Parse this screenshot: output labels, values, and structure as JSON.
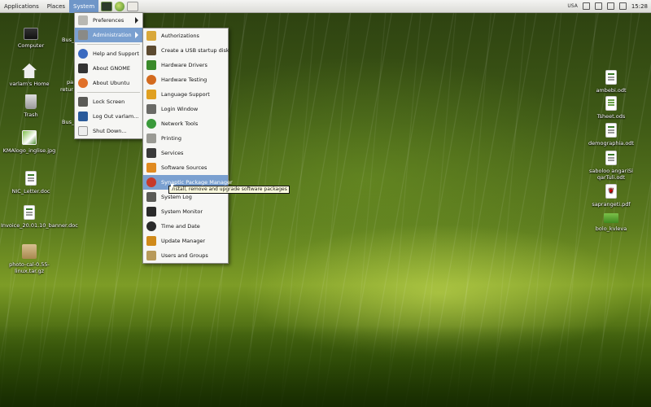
{
  "panel": {
    "menus": [
      "Applications",
      "Places",
      "System"
    ],
    "keyboard_layout": "USA",
    "clock": "15:28"
  },
  "desktop_left": [
    {
      "label": "Computer",
      "icon": "computer-icon"
    },
    {
      "label": "varlam's Home",
      "icon": "home-folder-icon"
    },
    {
      "label": "Trash",
      "icon": "trash-icon"
    },
    {
      "label": "KMAlogo_inglise.jpg",
      "icon": "image-file-icon"
    },
    {
      "label": "NIC_Letter.doc",
      "icon": "document-icon"
    },
    {
      "label": "Invoice_20.01.10_banner.doc",
      "icon": "document-icon"
    },
    {
      "label": "photo-cal-0.55-linux.tar.gz",
      "icon": "archive-icon"
    }
  ],
  "desktop_fragments": [
    "Bus_",
    "pa",
    "retur",
    "Bus_"
  ],
  "desktop_right": [
    {
      "label": "ambebi.odt",
      "icon": "document-icon"
    },
    {
      "label": "Tsheet.ods",
      "icon": "spreadsheet-icon"
    },
    {
      "label": "demographia.odt",
      "icon": "document-icon"
    },
    {
      "label": "saboloo angariSi qarTuli.odt",
      "icon": "document-icon"
    },
    {
      "label": "saprangeti.pdf",
      "icon": "pdf-icon"
    },
    {
      "label": "bolo_kvleva",
      "icon": "folder-icon"
    }
  ],
  "system_menu": {
    "items": [
      {
        "label": "Preferences",
        "submenu": true
      },
      {
        "label": "Administration",
        "submenu": true,
        "selected": true
      },
      {
        "label": "Help and Support"
      },
      {
        "label": "About GNOME"
      },
      {
        "label": "About Ubuntu"
      },
      {
        "label": "Lock Screen"
      },
      {
        "label": "Log Out varlam..."
      },
      {
        "label": "Shut Down..."
      }
    ]
  },
  "admin_menu": {
    "items": [
      {
        "label": "Authorizations",
        "color": "#d9a83a"
      },
      {
        "label": "Create a USB startup disk",
        "color": "#5c4a30"
      },
      {
        "label": "Hardware Drivers",
        "color": "#3a8a2a"
      },
      {
        "label": "Hardware Testing",
        "color": "#d36a1e"
      },
      {
        "label": "Language Support",
        "color": "#e0a020"
      },
      {
        "label": "Login Window",
        "color": "#6a6a66"
      },
      {
        "label": "Network Tools",
        "color": "#3a9a3a"
      },
      {
        "label": "Printing",
        "color": "#9a9a94"
      },
      {
        "label": "Services",
        "color": "#3a3a3a"
      },
      {
        "label": "Software Sources",
        "color": "#e08a20"
      },
      {
        "label": "Synaptic Package Manager",
        "color": "#c83a2a",
        "selected": true
      },
      {
        "label": "System Log",
        "color": "#5a5a56"
      },
      {
        "label": "System Monitor",
        "color": "#2a2a2a"
      },
      {
        "label": "Time and Date",
        "color": "#2a2a2a"
      },
      {
        "label": "Update Manager",
        "color": "#d08a1a"
      },
      {
        "label": "Users and Groups",
        "color": "#b89a5a"
      }
    ]
  },
  "tooltip": "Install, remove and upgrade software packages"
}
